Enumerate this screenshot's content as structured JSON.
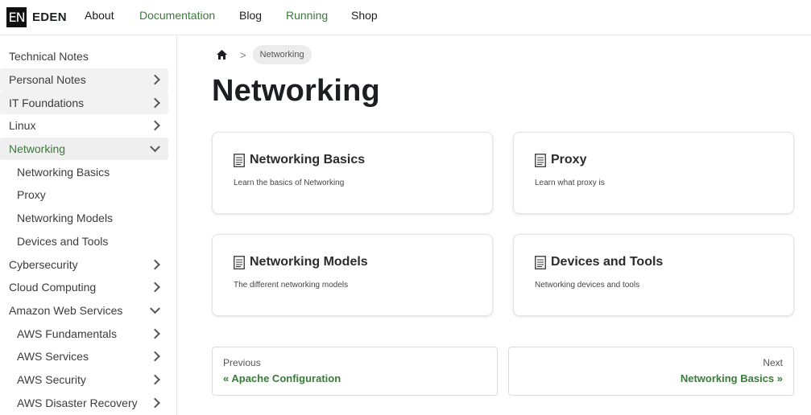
{
  "navbar": {
    "logo_text": "EN",
    "brand": "EDEN",
    "links": [
      "About",
      "Documentation",
      "Blog",
      "Running",
      "Shop"
    ]
  },
  "sidebar": {
    "items": [
      {
        "label": "Technical Notes",
        "chevron": "none"
      },
      {
        "label": "Personal Notes",
        "chevron": "right"
      },
      {
        "label": "IT Foundations",
        "chevron": "right"
      },
      {
        "label": "Linux",
        "chevron": "right"
      },
      {
        "label": "Networking",
        "chevron": "down",
        "active": true
      },
      {
        "label": "Networking Basics",
        "chevron": "none"
      },
      {
        "label": "Proxy",
        "chevron": "none"
      },
      {
        "label": "Networking Models",
        "chevron": "none"
      },
      {
        "label": "Devices and Tools",
        "chevron": "none"
      },
      {
        "label": "Cybersecurity",
        "chevron": "right"
      },
      {
        "label": "Cloud Computing",
        "chevron": "right"
      },
      {
        "label": "Amazon Web Services",
        "chevron": "down"
      },
      {
        "label": "AWS Fundamentals",
        "chevron": "right"
      },
      {
        "label": "AWS Services",
        "chevron": "right"
      },
      {
        "label": "AWS Security",
        "chevron": "right"
      },
      {
        "label": "AWS Disaster Recovery",
        "chevron": "right"
      }
    ]
  },
  "breadcrumb": {
    "home_icon": "home-icon",
    "separator": ">",
    "current": "Networking"
  },
  "page": {
    "title": "Networking"
  },
  "cards": [
    {
      "title": "Networking Basics",
      "description": "Learn the basics of Networking"
    },
    {
      "title": "Proxy",
      "description": "Learn what proxy is"
    },
    {
      "title": "Networking Models",
      "description": "The different networking models"
    },
    {
      "title": "Devices and Tools",
      "description": "Networking devices and tools"
    }
  ],
  "pagination": {
    "previous_label": "Previous",
    "previous_link": "« Apache Configuration",
    "next_label": "Next",
    "next_link": "Networking Basics »"
  },
  "colors": {
    "accent": "#3a7a3a",
    "text": "#1c1e21"
  }
}
